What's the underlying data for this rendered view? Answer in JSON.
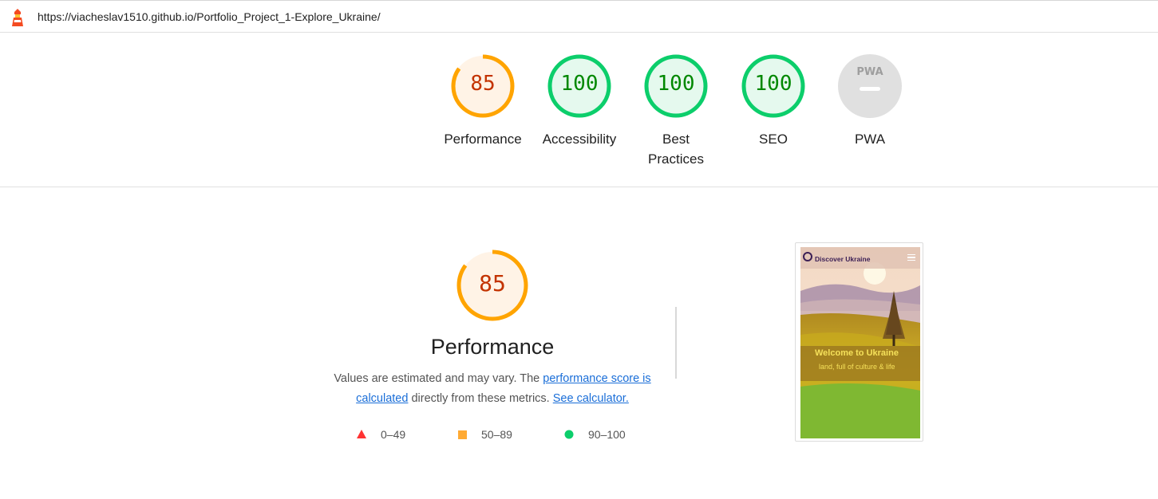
{
  "url_bar": {
    "url": "https://viacheslav1510.github.io/Portfolio_Project_1-Explore_Ukraine/"
  },
  "gauges": [
    {
      "label": "Performance",
      "score": "85",
      "status": "average"
    },
    {
      "label": "Accessibility",
      "score": "100",
      "status": "pass"
    },
    {
      "label": "Best Practices",
      "score": "100",
      "status": "pass"
    },
    {
      "label": "SEO",
      "score": "100",
      "status": "pass"
    },
    {
      "label": "PWA",
      "score": "PWA",
      "status": "na"
    }
  ],
  "performance": {
    "score": "85",
    "title": "Performance",
    "desc_prefix": "Values are estimated and may vary. The ",
    "link_score": "performance score is calculated",
    "desc_middle": " directly from these metrics. ",
    "link_calc": "See calculator.",
    "legend": [
      {
        "range": "0–49",
        "color": "#ff3333",
        "shape": "triangle"
      },
      {
        "range": "50–89",
        "color": "#ffaa33",
        "shape": "square"
      },
      {
        "range": "90–100",
        "color": "#0cce6b",
        "shape": "circle"
      }
    ]
  },
  "screenshot": {
    "brand": "Discover Ukraine",
    "heading": "Welcome to Ukraine",
    "subheading": "land, full of culture & life"
  },
  "colors": {
    "average": "#ffa400",
    "average_text": "#c33300",
    "average_bg": "#fff3e6",
    "pass": "#0cce6b",
    "pass_text": "#008800",
    "pass_bg": "#e5f9ee",
    "na_bg": "#e0e0e0"
  }
}
